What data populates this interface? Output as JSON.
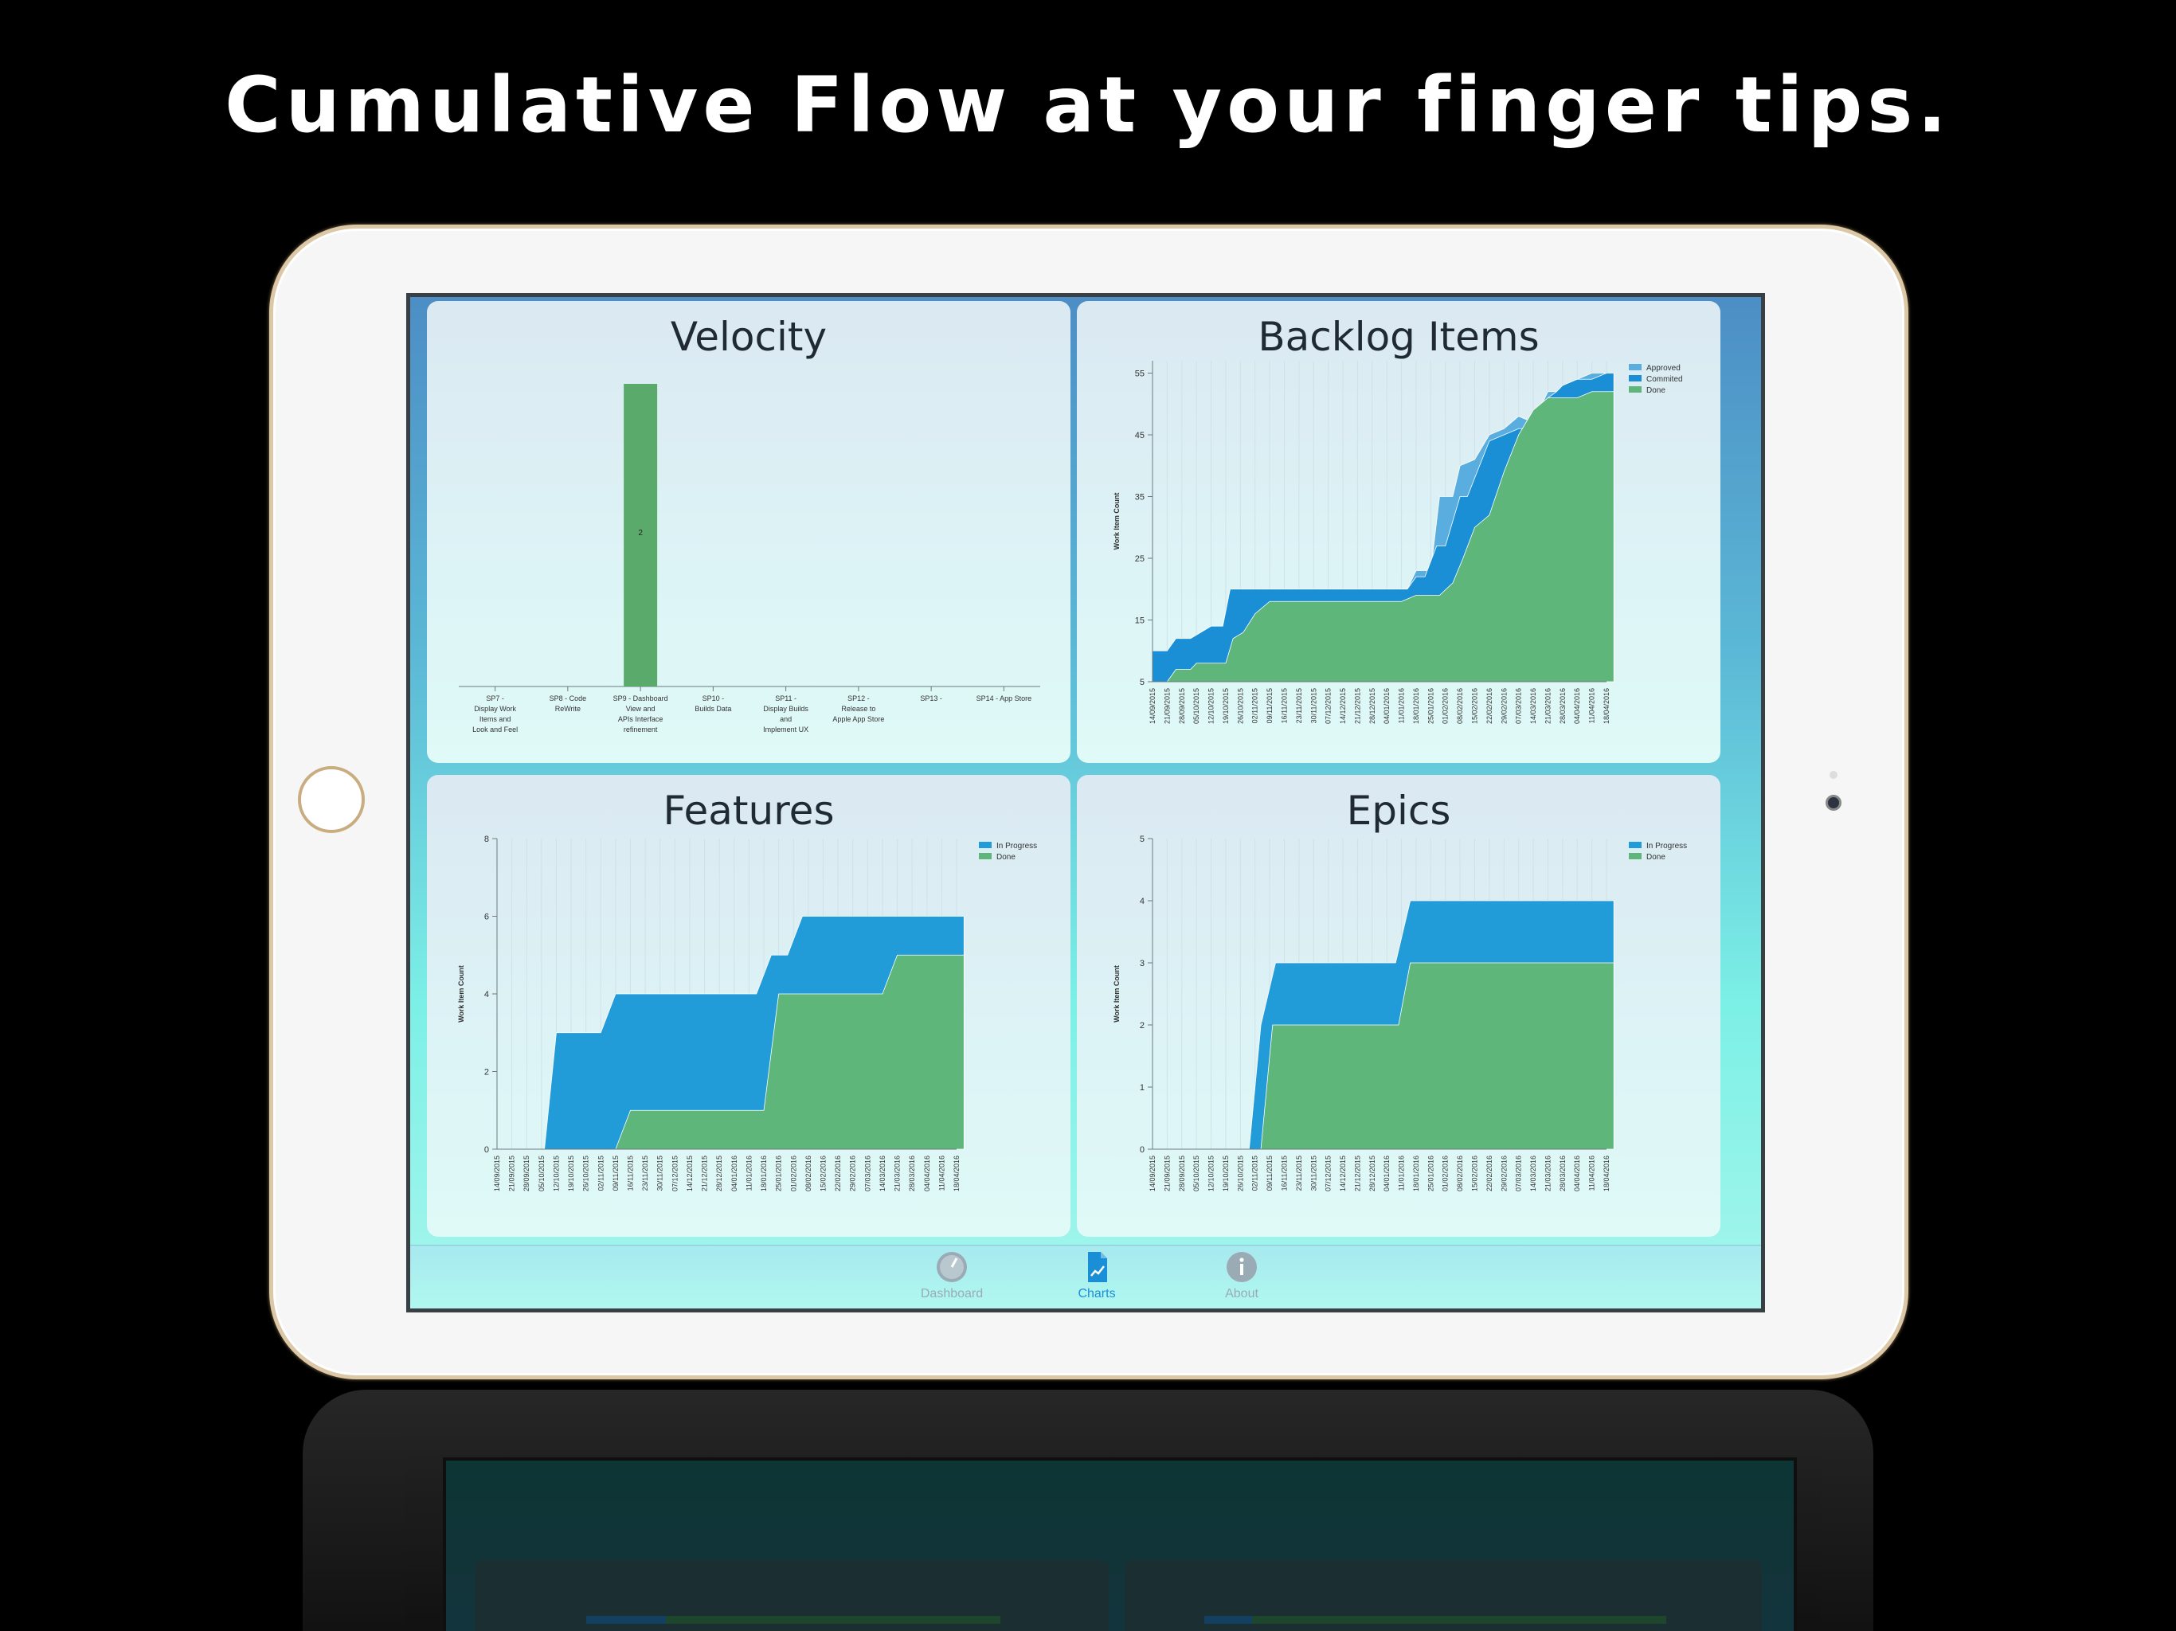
{
  "headline": "Cumulative Flow at your finger tips.",
  "colors": {
    "background": "#000000",
    "approved": "#5aaedf",
    "committed": "#1a8fd6",
    "in_progress": "#229bd9",
    "done": "#5fb67a",
    "velocity_bar": "#5aaa6c",
    "tab_active": "#1a8fd6",
    "tab_inactive": "#9aabb5"
  },
  "tabs": [
    {
      "label": "Dashboard",
      "icon": "gauge-icon",
      "active": false
    },
    {
      "label": "Charts",
      "icon": "chart-document-icon",
      "active": true
    },
    {
      "label": "About",
      "icon": "info-icon",
      "active": false
    }
  ],
  "dates_full": [
    "14/09/2015",
    "21/09/2015",
    "28/09/2015",
    "05/10/2015",
    "12/10/2015",
    "19/10/2015",
    "26/10/2015",
    "02/11/2015",
    "09/11/2015",
    "16/11/2015",
    "23/11/2015",
    "30/11/2015",
    "07/12/2015",
    "14/12/2015",
    "21/12/2015",
    "28/12/2015",
    "04/01/2016",
    "11/01/2016",
    "18/01/2016",
    "25/01/2016",
    "01/02/2016",
    "08/02/2016",
    "15/02/2016",
    "22/02/2016",
    "29/02/2016",
    "07/03/2016",
    "14/03/2016",
    "21/03/2016",
    "28/03/2016",
    "04/04/2016",
    "11/04/2016",
    "18/04/2016"
  ],
  "charts": {
    "velocity": {
      "title": "Velocity",
      "chart_data": {
        "type": "bar",
        "categories": [
          "SP7 - Display Work Items and Look and Feel",
          "SP8 - Code ReWrite",
          "SP9 - Dashboard View and APIs Interface refinement",
          "SP10 - Builds Data",
          "SP11 - Display Builds and Implement UX",
          "SP12 - Release to Apple App Store",
          "SP13 -",
          "SP14 - App Store"
        ],
        "category_lines": [
          [
            "SP7 -",
            "Display Work",
            "Items and",
            "Look and Feel"
          ],
          [
            "SP8 - Code",
            "ReWrite"
          ],
          [
            "SP9 - Dashboard",
            "View and",
            "APIs Interface",
            "refinement"
          ],
          [
            "SP10 -",
            "Builds Data"
          ],
          [
            "SP11 -",
            "Display Builds",
            "and",
            "Implement UX"
          ],
          [
            "SP12 -",
            "Release to",
            "Apple App Store"
          ],
          [
            "SP13 -"
          ],
          [
            "SP14 - App Store"
          ]
        ],
        "values": [
          0,
          0,
          2,
          0,
          0,
          0,
          0,
          0
        ],
        "data_labels": [
          "",
          "",
          "2",
          "",
          "",
          "",
          "",
          ""
        ],
        "ylim": [
          0,
          2
        ]
      }
    },
    "backlog": {
      "title": "Backlog Items",
      "chart_data": {
        "type": "area",
        "ylabel": "Work Item Count",
        "yticks": [
          "5",
          "15",
          "25",
          "35",
          "45",
          "55"
        ],
        "ylim": [
          5,
          57
        ],
        "legend": [
          "Approved",
          "Commited",
          "Done"
        ],
        "legend_position": "top-right",
        "series": [
          {
            "name": "Approved",
            "x": [
              0,
              1,
              1.6,
              2.6,
              4,
              4.8,
              5.3,
              6.5,
              8,
              10,
              12,
              14,
              16,
              17.4,
              18,
              19,
              19.6,
              20.5,
              21,
              22,
              23,
              24,
              25,
              26,
              26.6,
              27,
              27.6,
              28,
              29,
              30,
              31,
              31.5
            ],
            "values": [
              10,
              10,
              12,
              12,
              14,
              14,
              20,
              20,
              20,
              20,
              20,
              20,
              20,
              20,
              23,
              23,
              35,
              35,
              40,
              41,
              45,
              46,
              48,
              47,
              50,
              52,
              52,
              53,
              54,
              55,
              55,
              55
            ]
          },
          {
            "name": "Commited",
            "x": [
              0,
              1,
              1.6,
              2.6,
              4,
              4.8,
              5.3,
              6.5,
              8,
              10,
              12,
              14,
              16,
              17.4,
              18,
              18.6,
              19.4,
              20,
              21,
              21.5,
              22,
              23,
              24,
              25,
              26,
              26.6,
              27,
              27.6,
              28,
              29,
              30,
              31,
              31.5
            ],
            "values": [
              10,
              10,
              12,
              12,
              14,
              14,
              20,
              20,
              20,
              20,
              20,
              20,
              20,
              20,
              22,
              22,
              27,
              27,
              35,
              35,
              38,
              44,
              45,
              46,
              46,
              50,
              51,
              52,
              53,
              54,
              54,
              55,
              55
            ]
          },
          {
            "name": "Done",
            "x": [
              0,
              1,
              1.6,
              2.6,
              3,
              4,
              5,
              5.5,
              6.2,
              7,
              8,
              10,
              12,
              14,
              16,
              17,
              18,
              19,
              19.6,
              20.5,
              21.2,
              22,
              23,
              24,
              25,
              26,
              27,
              28,
              29,
              30,
              31,
              31.5
            ],
            "values": [
              5,
              5,
              7,
              7,
              8,
              8,
              8,
              12,
              13,
              16,
              18,
              18,
              18,
              18,
              18,
              18,
              19,
              19,
              19,
              21,
              25,
              30,
              32,
              39,
              45,
              49,
              51,
              51,
              51,
              52,
              52,
              52
            ]
          }
        ]
      }
    },
    "features": {
      "title": "Features",
      "chart_data": {
        "type": "area",
        "ylabel": "Work Item Count",
        "yticks": [
          "0",
          "2",
          "4",
          "6",
          "8"
        ],
        "ylim": [
          0,
          8
        ],
        "legend": [
          "In Progress",
          "Done"
        ],
        "legend_position": "top-right",
        "series": [
          {
            "name": "In Progress",
            "x": [
              0,
              3.2,
              4,
              7,
              8,
              17.5,
              18.5,
              19.6,
              20.6,
              31.5
            ],
            "values": [
              0,
              0,
              3,
              3,
              4,
              4,
              5,
              5,
              6,
              6
            ]
          },
          {
            "name": "Done",
            "x": [
              0,
              8,
              9,
              18,
              19,
              26,
              27,
              31.5
            ],
            "values": [
              0,
              0,
              1,
              1,
              4,
              4,
              5,
              5
            ]
          }
        ]
      }
    },
    "epics": {
      "title": "Epics",
      "chart_data": {
        "type": "area",
        "ylabel": "Work Item Count",
        "yticks": [
          "0",
          "1",
          "2",
          "3",
          "4",
          "5"
        ],
        "ylim": [
          0,
          5
        ],
        "legend": [
          "In Progress",
          "Done"
        ],
        "legend_position": "top-right",
        "series": [
          {
            "name": "In Progress",
            "x": [
              0,
              6.6,
              7.4,
              8.4,
              16.6,
              17.6,
              31.5
            ],
            "values": [
              0,
              0,
              2,
              3,
              3,
              4,
              4
            ]
          },
          {
            "name": "Done",
            "x": [
              0,
              7.4,
              8.2,
              16.8,
              17.6,
              31.5
            ],
            "values": [
              0,
              0,
              2,
              2,
              3,
              3
            ]
          }
        ]
      }
    }
  }
}
